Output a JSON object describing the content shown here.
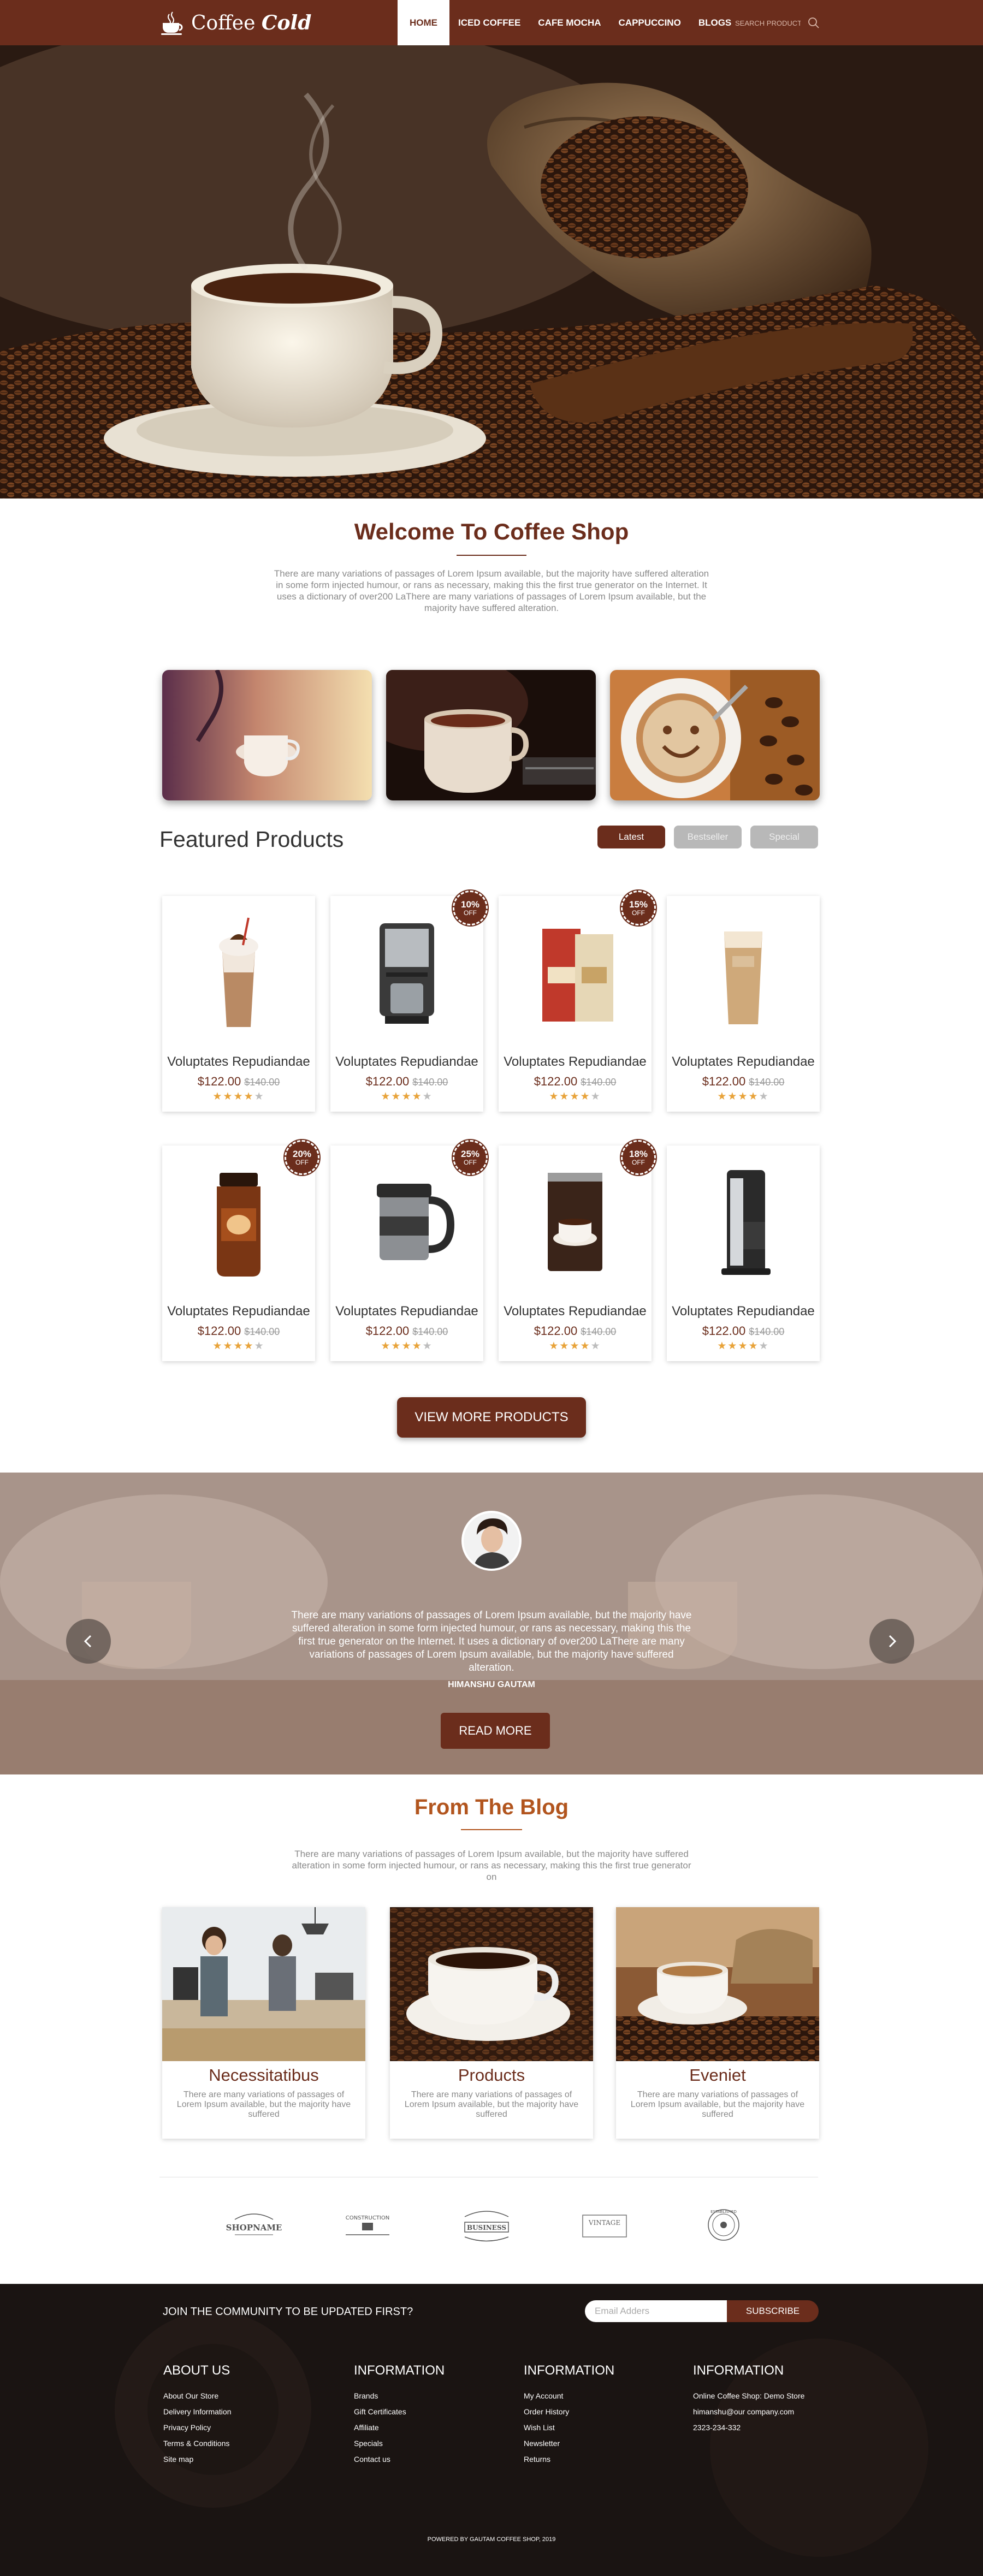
{
  "header": {
    "logo_text_1": "Coffee",
    "logo_text_2": "Cold",
    "nav": [
      "HOME",
      "ICED COFFEE",
      "CAFE MOCHA",
      "CAPPUCCINO",
      "BLOGS"
    ],
    "search_placeholder": "SEARCH PRODUCT",
    "search_icon": "search-icon"
  },
  "hero": {
    "slides": 3,
    "active_slide": 1
  },
  "welcome": {
    "title": "Welcome To Coffee Shop",
    "text": "There are many variations of passages of Lorem Ipsum available, but the majority have suffered alteration in some form injected humour, or rans as necessary, making this the first true generator on the Internet. It uses a dictionary of over200 LaThere are many variations of passages of Lorem Ipsum available, but the majority have suffered alteration."
  },
  "featured": {
    "title": "Featured Products",
    "tabs": [
      "Latest",
      "Bestseller",
      "Special"
    ],
    "active_tab": "Latest",
    "products": [
      {
        "name": "Voluptates Repudiandae",
        "price": "$122.00",
        "old_price": "$140.00",
        "rating": 4,
        "badge": ""
      },
      {
        "name": "Voluptates Repudiandae",
        "price": "$122.00",
        "old_price": "$140.00",
        "rating": 4,
        "badge": "10%"
      },
      {
        "name": "Voluptates Repudiandae",
        "price": "$122.00",
        "old_price": "$140.00",
        "rating": 4,
        "badge": "15%"
      },
      {
        "name": "Voluptates Repudiandae",
        "price": "$122.00",
        "old_price": "$140.00",
        "rating": 4,
        "badge": ""
      },
      {
        "name": "Voluptates Repudiandae",
        "price": "$122.00",
        "old_price": "$140.00",
        "rating": 4,
        "badge": "20%"
      },
      {
        "name": "Voluptates Repudiandae",
        "price": "$122.00",
        "old_price": "$140.00",
        "rating": 4,
        "badge": "25%"
      },
      {
        "name": "Voluptates Repudiandae",
        "price": "$122.00",
        "old_price": "$140.00",
        "rating": 4,
        "badge": "18%"
      },
      {
        "name": "Voluptates Repudiandae",
        "price": "$122.00",
        "old_price": "$140.00",
        "rating": 4,
        "badge": ""
      }
    ],
    "badge_off_label": "OFF",
    "view_more": "VIEW MORE PRODUCTS"
  },
  "testimonial": {
    "quote": "There are many variations of passages of Lorem Ipsum available, but the majority have suffered alteration in some form injected humour, or rans as necessary, making this the first true generator on the Internet. It uses a dictionary of over200 LaThere are many variations of passages of Lorem Ipsum available, but the majority have suffered alteration.",
    "author": "HIMANSHU GAUTAM",
    "read_more": "READ MORE"
  },
  "blog": {
    "title": "From The Blog",
    "text": "There are many variations of passages of Lorem Ipsum available, but the majority have suffered alteration in some form injected humour, or rans as necessary, making this the first true generator on",
    "posts": [
      {
        "title": "Necessitatibus",
        "desc": "There are many variations of passages of Lorem Ipsum available, but the majority have suffered"
      },
      {
        "title": "Products",
        "desc": "There are many variations of passages of Lorem Ipsum available, but the majority have suffered"
      },
      {
        "title": "Eveniet",
        "desc": "There are many variations of passages of Lorem Ipsum available, but the majority have suffered"
      }
    ]
  },
  "brands": [
    "SHOPNAME",
    "CONSTRUCTION",
    "BUSINESS",
    "VINTAGE",
    "ESTABLISHED"
  ],
  "footer": {
    "join_text": "JOIN THE COMMUNITY TO BE UPDATED FIRST?",
    "email_placeholder": "Email Adders",
    "subscribe": "SUBSCRIBE",
    "columns": [
      {
        "title": "ABOUT US",
        "links": [
          "About Our Store",
          "Delivery Information",
          "Privacy Policy",
          "Terms & Conditions",
          "Site map"
        ]
      },
      {
        "title": "INFORMATION",
        "links": [
          "Brands",
          "Gift Certificates",
          "Affiliate",
          "Specials",
          "Contact us"
        ]
      },
      {
        "title": "INFORMATION",
        "links": [
          "My Account",
          "Order History",
          "Wish List",
          "Newsletter",
          "Returns"
        ]
      },
      {
        "title": "INFORMATION",
        "links": [
          "Online Coffee Shop: Demo Store",
          "himanshu@our company.com",
          "2323-234-332"
        ]
      }
    ],
    "copyright": "POWERED BY GAUTAM COFFEE SHOP, 2019"
  },
  "colors": {
    "brand": "#6b2d1c",
    "accent": "#b2551e",
    "star": "#e8a33a"
  }
}
